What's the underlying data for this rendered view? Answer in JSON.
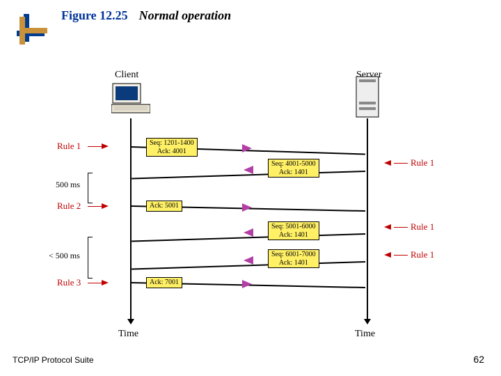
{
  "figure": {
    "number": "Figure 12.25",
    "title": "Normal operation"
  },
  "endpoints": {
    "client": "Client",
    "server": "Server"
  },
  "messages": {
    "m1": "Seq: 1201-1400\nAck: 4001",
    "m2": "Seq: 4001-5000\nAck: 1401",
    "m3": "Ack: 5001",
    "m4": "Seq: 5001-6000\nAck: 1401",
    "m5": "Seq: 6001-7000\nAck: 1401",
    "m6": "Ack: 7001"
  },
  "rules": {
    "left_r1": "Rule 1",
    "left_r2": "Rule 2",
    "left_r3": "Rule 3",
    "right_r1a": "Rule 1",
    "right_r1b": "Rule 1",
    "right_r1c": "Rule 1"
  },
  "timing": {
    "gap1": "500 ms",
    "gap2": "< 500 ms",
    "time_label": "Time"
  },
  "footer": {
    "left": "TCP/IP Protocol Suite",
    "page": "62"
  }
}
